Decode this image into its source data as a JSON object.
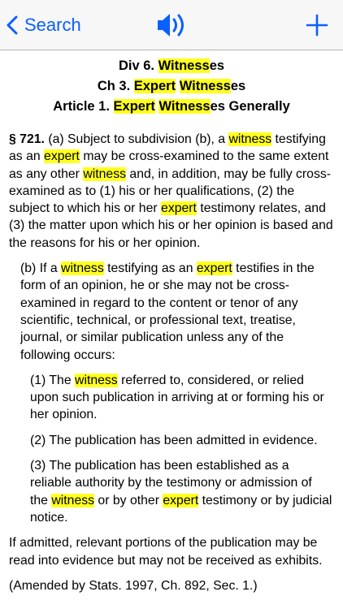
{
  "nav": {
    "back_label": "Search",
    "back_icon": "chevron-left-icon",
    "audio_icon": "speaker-icon",
    "add_icon": "plus-icon",
    "accent": "#0a60ff"
  },
  "highlight_color": "#ffff20",
  "heading": {
    "div": [
      "Div 6. ",
      "Witness",
      "es"
    ],
    "ch": [
      "Ch 3. ",
      "Expert",
      " ",
      "Witness",
      "es"
    ],
    "article": [
      "Article 1. ",
      "Expert",
      " ",
      "Witness",
      "es Generally"
    ]
  },
  "section": {
    "number": "§ 721.",
    "a": [
      "(a) Subject to subdivision (b), a ",
      "witness",
      " testifying as an ",
      "expert",
      " may be cross-examined to the same extent as any other ",
      "witness",
      " and, in addition, may be fully cross-examined as to (1) his or her qualifications, (2) the subject to which his or her ",
      "expert",
      " testimony relates, and (3) the matter upon which his or her opinion is based and the reasons for his or her opinion."
    ],
    "b": [
      "(b) If a ",
      "witness",
      " testifying as an ",
      "expert",
      " testifies in the form of an opinion, he or she may not be cross-examined in regard to the content or tenor of any scientific, technical, or professional text, treatise, journal, or similar publication unless any of the following occurs:"
    ],
    "b1": [
      "(1) The ",
      "witness",
      " referred to, considered, or relied upon such publication in arriving at or forming his or her opinion."
    ],
    "b2": "(2) The publication has been admitted in evidence.",
    "b3": [
      "(3) The publication has been established as a reliable authority by the testimony or admission of the ",
      "witness",
      " or by other ",
      "expert",
      " testimony or by judicial notice."
    ],
    "tail": "If admitted, relevant portions of the publication may be read into evidence but may not be received as exhibits.",
    "amended": "(Amended by Stats. 1997, Ch. 892, Sec. 1.)"
  }
}
